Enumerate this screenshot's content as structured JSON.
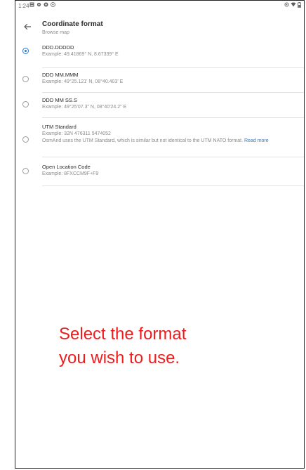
{
  "status_bar": {
    "time": "1:24",
    "left_icons": [
      "notification-icon",
      "settings-icon",
      "shield-icon",
      "cast-icon"
    ],
    "right_icons": [
      "location-icon",
      "wifi-icon",
      "battery-icon"
    ]
  },
  "header": {
    "title": "Coordinate format",
    "subtitle": "Browse map"
  },
  "options": [
    {
      "label": "DDD.DDDDD",
      "example": "Example: 49.41869° N, 8.67339° E",
      "selected": true
    },
    {
      "label": "DDD MM.MMM",
      "example": "Example: 49°25.121' N, 08°40.403' E",
      "selected": false
    },
    {
      "label": "DDD MM SS.S",
      "example": "Example: 49°25'07.3\" N, 08°40'24.2\" E",
      "selected": false
    },
    {
      "label": "UTM Standard",
      "example": "Example: 32N 476311 5474052",
      "note": "OsmAnd uses the UTM Standard, which is similar but not identical to the UTM NATO format.",
      "link": "Read more",
      "selected": false
    },
    {
      "label": "Open Location Code",
      "example": "Example: 8FXCCM9F+F9",
      "selected": false
    }
  ],
  "instruction": {
    "line1": "Select the format",
    "line2": "you wish to use."
  },
  "colors": {
    "accent": "#237bd3",
    "instruction": "#ee1c1c"
  }
}
